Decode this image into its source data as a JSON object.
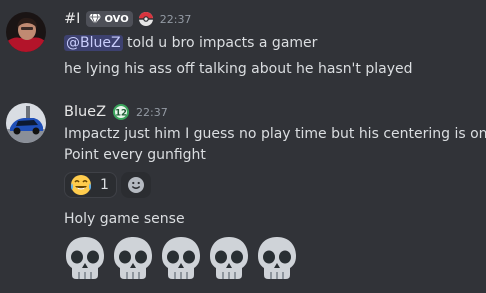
{
  "messages": [
    {
      "author": "#I",
      "author_color": "#e6e6e6",
      "guild_tag": "OVO",
      "timestamp": "22:37",
      "avatar": "avatar-person",
      "lines": [
        {
          "mention": "@BlueZ",
          "text": " told u bro impacts a gamer"
        },
        {
          "text": "he lying his ass off talking about he hasn't played"
        }
      ]
    },
    {
      "author": "BlueZ",
      "author_color": "#e6e6e6",
      "badge": "12",
      "timestamp": "22:37",
      "avatar": "avatar-car",
      "lines": [
        {
          "text": "Impactz just him I guess no play time but his centering is on"
        },
        {
          "text": "Point every gunfight"
        }
      ],
      "reaction": {
        "emoji": "joy-emoji",
        "count": "1"
      }
    },
    {
      "lines": [
        {
          "text": "Holy game sense"
        }
      ],
      "emoji_row": [
        "skull-emoji",
        "skull-emoji",
        "skull-emoji",
        "skull-emoji",
        "skull-emoji"
      ]
    }
  ],
  "colors": {
    "background": "#313338",
    "mention_bg": "#5865f2",
    "badge_green": "#3ba55d"
  }
}
